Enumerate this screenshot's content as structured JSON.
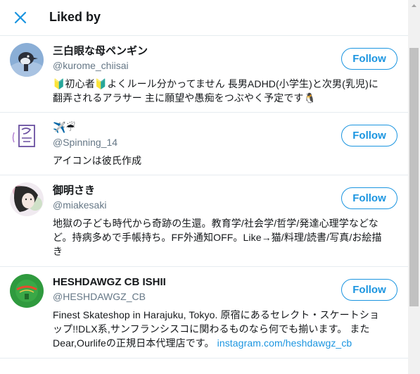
{
  "header": {
    "title": "Liked by",
    "close_icon": "close-icon"
  },
  "users": [
    {
      "name": "三白眼な母ペンギン",
      "handle": "@kurome_chiisai",
      "bio": "🔰初心者🔰よくルール分かってません 長男ADHD(小学生)と次男(乳児)に翻弄されるアラサー 主に願望や愚痴をつぶやく予定です🐧",
      "follow_label": "Follow",
      "avatar_icon": "penguin-avatar"
    },
    {
      "name": "✈️☔",
      "handle": "@Spinning_14",
      "bio": "アイコンは彼氏作成",
      "follow_label": "Follow",
      "avatar_icon": "sketch-avatar"
    },
    {
      "name": "御明さき",
      "handle": "@miakesaki",
      "bio": "地獄の子ども時代から奇跡の生還。教育学/社会学/哲学/発達心理学などなど。持病多めで手帳持ち。FF外通知OFF。Like→猫/料理/読書/写真/お絵描き",
      "follow_label": "Follow",
      "avatar_icon": "illustration-avatar"
    },
    {
      "name": "HESHDAWGZ CB ISHII",
      "handle": "@HESHDAWGZ_CB",
      "bio": "Finest Skateshop in Harajuku, Tokyo. 原宿にあるセレクト・スケートショップ!!DLX系,サンフランシスコに関わるものなら何でも揃います。 また Dear,Ourlifeの正規日本代理店です。",
      "bio_link": "instagram.com/heshdawgz_cb",
      "follow_label": "Follow",
      "avatar_icon": "green-logo-avatar"
    }
  ],
  "colors": {
    "accent": "#1b95e0",
    "border": "#e6ecf0",
    "secondary_text": "#657786"
  }
}
